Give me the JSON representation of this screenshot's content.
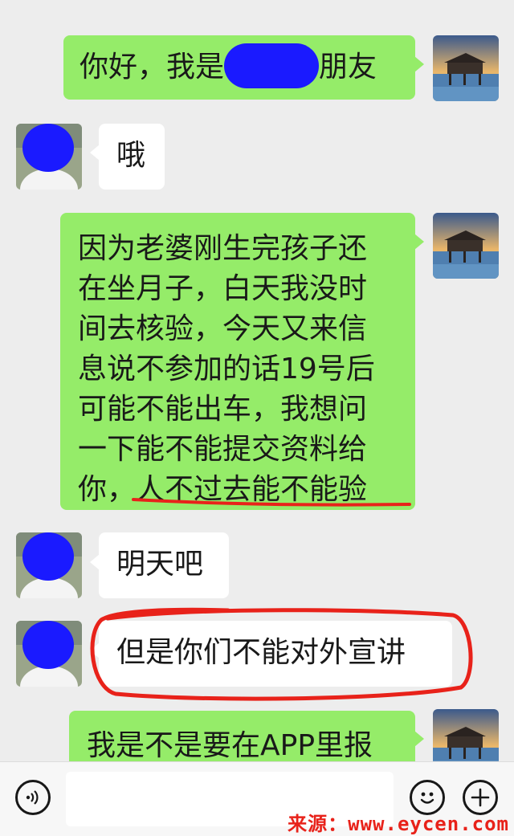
{
  "messages": [
    {
      "side": "right",
      "pre": "你好，我是",
      "redacted": true,
      "post": "朋友"
    },
    {
      "side": "left",
      "text": "哦"
    },
    {
      "side": "right",
      "lines": [
        "因为老婆刚生完孩子还",
        "在坐月子，白天我没时",
        "间去核验，今天又来信",
        "息说不参加的话19号后",
        "可能不能出车，我想问",
        "一下能不能提交资料给"
      ],
      "last_pre": "你，",
      "last_underlined": "人不过去能不能验"
    },
    {
      "side": "left",
      "text": "明天吧"
    },
    {
      "side": "left",
      "text": "但是你们不能对外宣讲",
      "circled": true
    },
    {
      "side": "right",
      "text": "我是不是要在APP里报"
    }
  ],
  "input_bar": {
    "voice_icon": "voice-icon",
    "emoji_icon": "smiley-icon",
    "plus_icon": "plus-icon",
    "input_value": ""
  },
  "watermark": "来源：www.eycen.com",
  "colors": {
    "my_bubble": "#95ec69",
    "other_bubble": "#ffffff",
    "background": "#ededed",
    "annotation": "#e8221a",
    "redaction": "#1a1aff"
  }
}
